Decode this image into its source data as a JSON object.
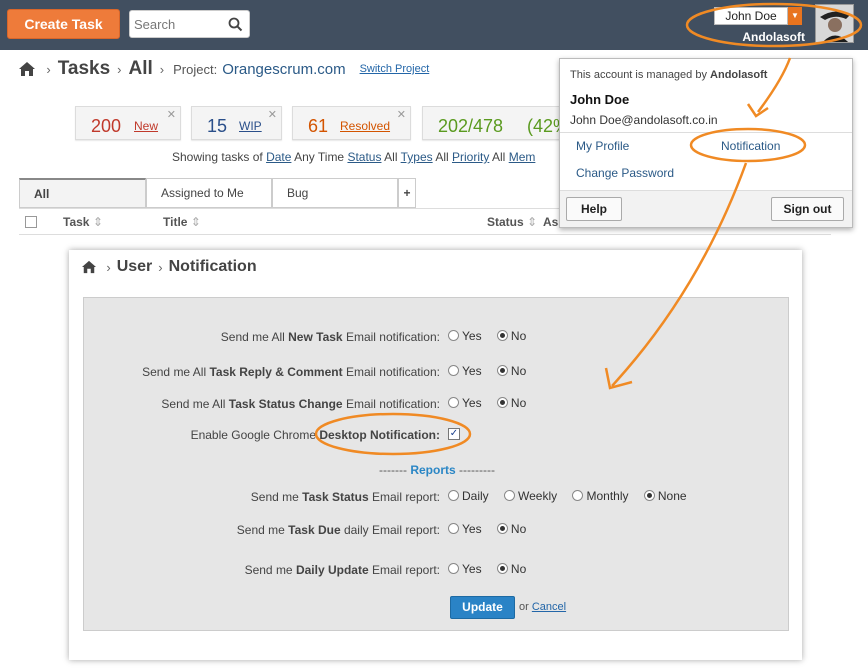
{
  "topbar": {
    "create_task_label": "Create Task",
    "search_placeholder": "Search",
    "user_name": "John Doe",
    "company": "Andolasoft"
  },
  "breadcrumb": {
    "section": "Tasks",
    "view": "All",
    "project_label": "Project:",
    "project_name": "Orangescrum.com",
    "switch_project": "Switch Project"
  },
  "stats": [
    {
      "count": "200",
      "label": "New",
      "color": "#c0392b"
    },
    {
      "count": "15",
      "label": "WIP",
      "color": "#2a4f8a"
    },
    {
      "count": "61",
      "label": "Resolved",
      "color": "#d35400"
    },
    {
      "count": "202/478",
      "label": "(42%",
      "color": "#5a9a1f"
    }
  ],
  "filters": {
    "prefix": "Showing tasks of",
    "date_label": "Date",
    "date_value": "Any Time",
    "status_label": "Status",
    "status_value": "All",
    "types_label": "Types",
    "types_value": "All",
    "priority_label": "Priority",
    "priority_value": "All",
    "members_label": "Mem"
  },
  "tabs": [
    {
      "label": "All"
    },
    {
      "label": "Assigned to Me"
    },
    {
      "label": "Bug"
    },
    {
      "label": "+"
    }
  ],
  "table": {
    "headers": [
      "Task",
      "Title",
      "Status",
      "Ass"
    ],
    "sort_icon": "⇕"
  },
  "account_menu": {
    "managed_by_text": "This account is managed by",
    "managed_by_company": "Andolasoft",
    "name": "John Doe",
    "email": "John Doe@andolasoft.co.in",
    "my_profile": "My Profile",
    "notification": "Notification",
    "change_password": "Change Password",
    "help": "Help",
    "sign_out": "Sign out"
  },
  "notification_page": {
    "crumb_user": "User",
    "crumb_notification": "Notification",
    "rows": [
      {
        "pre": "Send me All ",
        "bold": "New Task",
        "post": " Email notification:",
        "options": [
          "Yes",
          "No"
        ],
        "selected": 1
      },
      {
        "pre": "Send me All ",
        "bold": "Task Reply & Comment",
        "post": " Email notification:",
        "options": [
          "Yes",
          "No"
        ],
        "selected": 1
      },
      {
        "pre": "Send me All ",
        "bold": "Task Status Change",
        "post": " Email notification:",
        "options": [
          "Yes",
          "No"
        ],
        "selected": 1
      }
    ],
    "desktop": {
      "pre": "Enable Google Chrome ",
      "bold": "Desktop Notification:",
      "checked": "✓"
    },
    "reports_heading": "Reports",
    "reports_dashes_left": "-------",
    "reports_dashes_right": "---------",
    "report_rows": [
      {
        "pre": "Send me ",
        "bold": "Task Status",
        "post": " Email report:",
        "options": [
          "Daily",
          "Weekly",
          "Monthly",
          "None"
        ],
        "selected": 3
      },
      {
        "pre": "Send me ",
        "bold": "Task Due",
        "post": " daily Email report:",
        "options": [
          "Yes",
          "No"
        ],
        "selected": 1
      },
      {
        "pre": "Send me ",
        "bold": "Daily Update",
        "post": " Email report:",
        "options": [
          "Yes",
          "No"
        ],
        "selected": 1
      }
    ],
    "update_label": "Update",
    "or_label": "or",
    "cancel_label": "Cancel"
  },
  "colors": {
    "topbar_bg": "#414f60",
    "accent_orange": "#ee7b3a",
    "annotation_orange": "#f08a24",
    "link_blue": "#2b5a87",
    "button_blue": "#2a83c6"
  }
}
